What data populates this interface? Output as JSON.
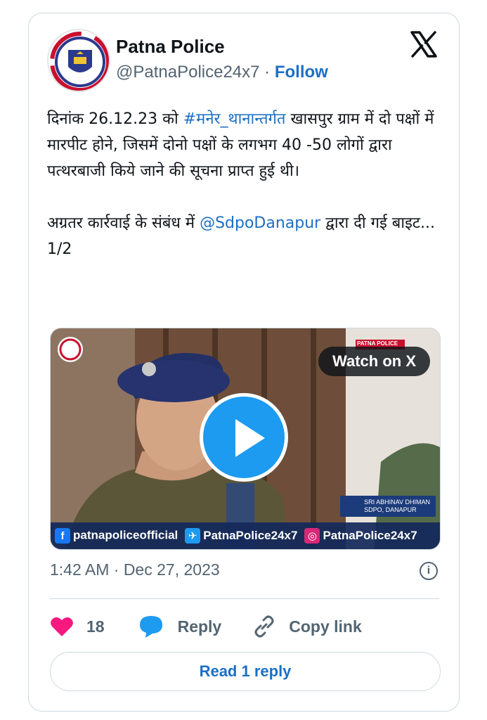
{
  "tweet": {
    "author_name": "Patna Police",
    "handle": "@PatnaPolice24x7",
    "separator": "·",
    "follow_label": "Follow",
    "body": {
      "p1_a": "दिनांक 26.12.23 को ",
      "p1_hashtag": "#मनेर_थानान्तर्गत",
      "p1_b": " खासपुर ग्राम में दो पक्षों में मारपीट होने, जिसमें दोनो पक्षों के लगभग 40 -50 लोगों द्वारा पत्थरबाजी किये जाने की सूचना प्राप्त हुई थी।",
      "p2_a": "अग्रतर कार्रवाई के संबंध में ",
      "p2_mention": "@SdpoDanapur",
      "p2_b": " द्वारा दी गई बाइट...",
      "p3": "1/2"
    },
    "media": {
      "watch_label": "Watch on X",
      "strip": {
        "facebook": "patnapoliceofficial",
        "twitter": "PatnaPolice24x7",
        "instagram": "PatnaPolice24x7"
      },
      "name_tag_line1": "SRI ABHINAV DHIMAN",
      "name_tag_line2": "SDPO, DANAPUR",
      "corner_tag": "PATNA POLICE"
    },
    "timestamp": "1:42 AM · Dec 27, 2023",
    "likes": "18",
    "reply_label": "Reply",
    "copy_link_label": "Copy link",
    "read_replies_label": "Read 1 reply"
  },
  "colors": {
    "link": "#1d6fc4",
    "like": "#f91880",
    "reply_icon": "#1d9bf0",
    "play": "#1d9bf0"
  },
  "icons": [
    "police-logo-icon",
    "x-logo-icon",
    "play-icon",
    "info-icon",
    "heart-icon",
    "reply-bubble-icon",
    "link-icon",
    "facebook-icon",
    "twitter-icon",
    "instagram-icon"
  ]
}
